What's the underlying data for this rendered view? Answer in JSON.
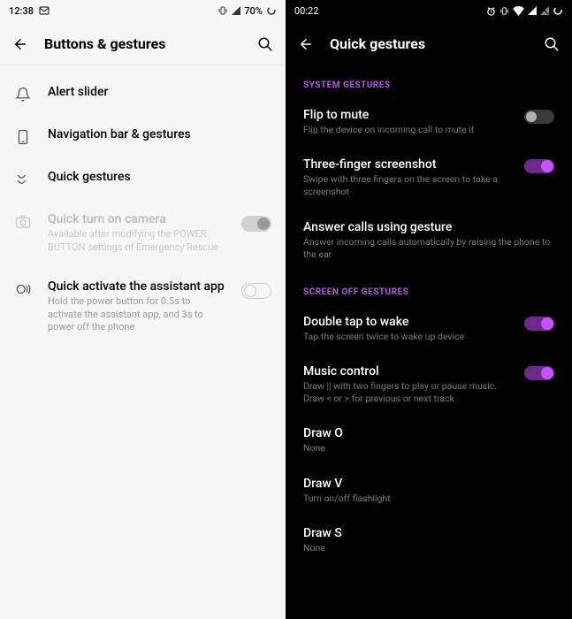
{
  "left": {
    "status": {
      "time": "12:38",
      "battery": "70%"
    },
    "title": "Buttons & gestures",
    "items": [
      {
        "label": "Alert slider"
      },
      {
        "label": "Navigation bar & gestures"
      },
      {
        "label": "Quick gestures"
      },
      {
        "label": "Quick turn on camera",
        "sub": "Available after modifying the POWER BUTTON settings of Emergency Rescue"
      },
      {
        "label": "Quick activate the assistant app",
        "sub": "Hold the power button for 0.5s to activate the assistant app, and 3s to power off the phone"
      }
    ]
  },
  "right": {
    "status": {
      "time": "00:22"
    },
    "title": "Quick gestures",
    "section1": "SYSTEM GESTURES",
    "section2": "SCREEN OFF GESTURES",
    "items": [
      {
        "label": "Flip to mute",
        "sub": "Flip the device on incoming call to mute it"
      },
      {
        "label": "Three-finger screenshot",
        "sub": "Swipe with three fingers on the screen to take a screenshot"
      },
      {
        "label": "Answer calls using gesture",
        "sub": "Answer incoming calls automatically by raising the phone to the ear"
      },
      {
        "label": "Double tap to wake",
        "sub": "Tap the screen twice to wake up device"
      },
      {
        "label": "Music control",
        "sub": "Draw || with two fingers to play or pause music. Draw < or > for previous or next track"
      },
      {
        "label": "Draw O",
        "sub": "None"
      },
      {
        "label": "Draw V",
        "sub": "Turn on/off flashlight"
      },
      {
        "label": "Draw S",
        "sub": "None"
      }
    ]
  }
}
